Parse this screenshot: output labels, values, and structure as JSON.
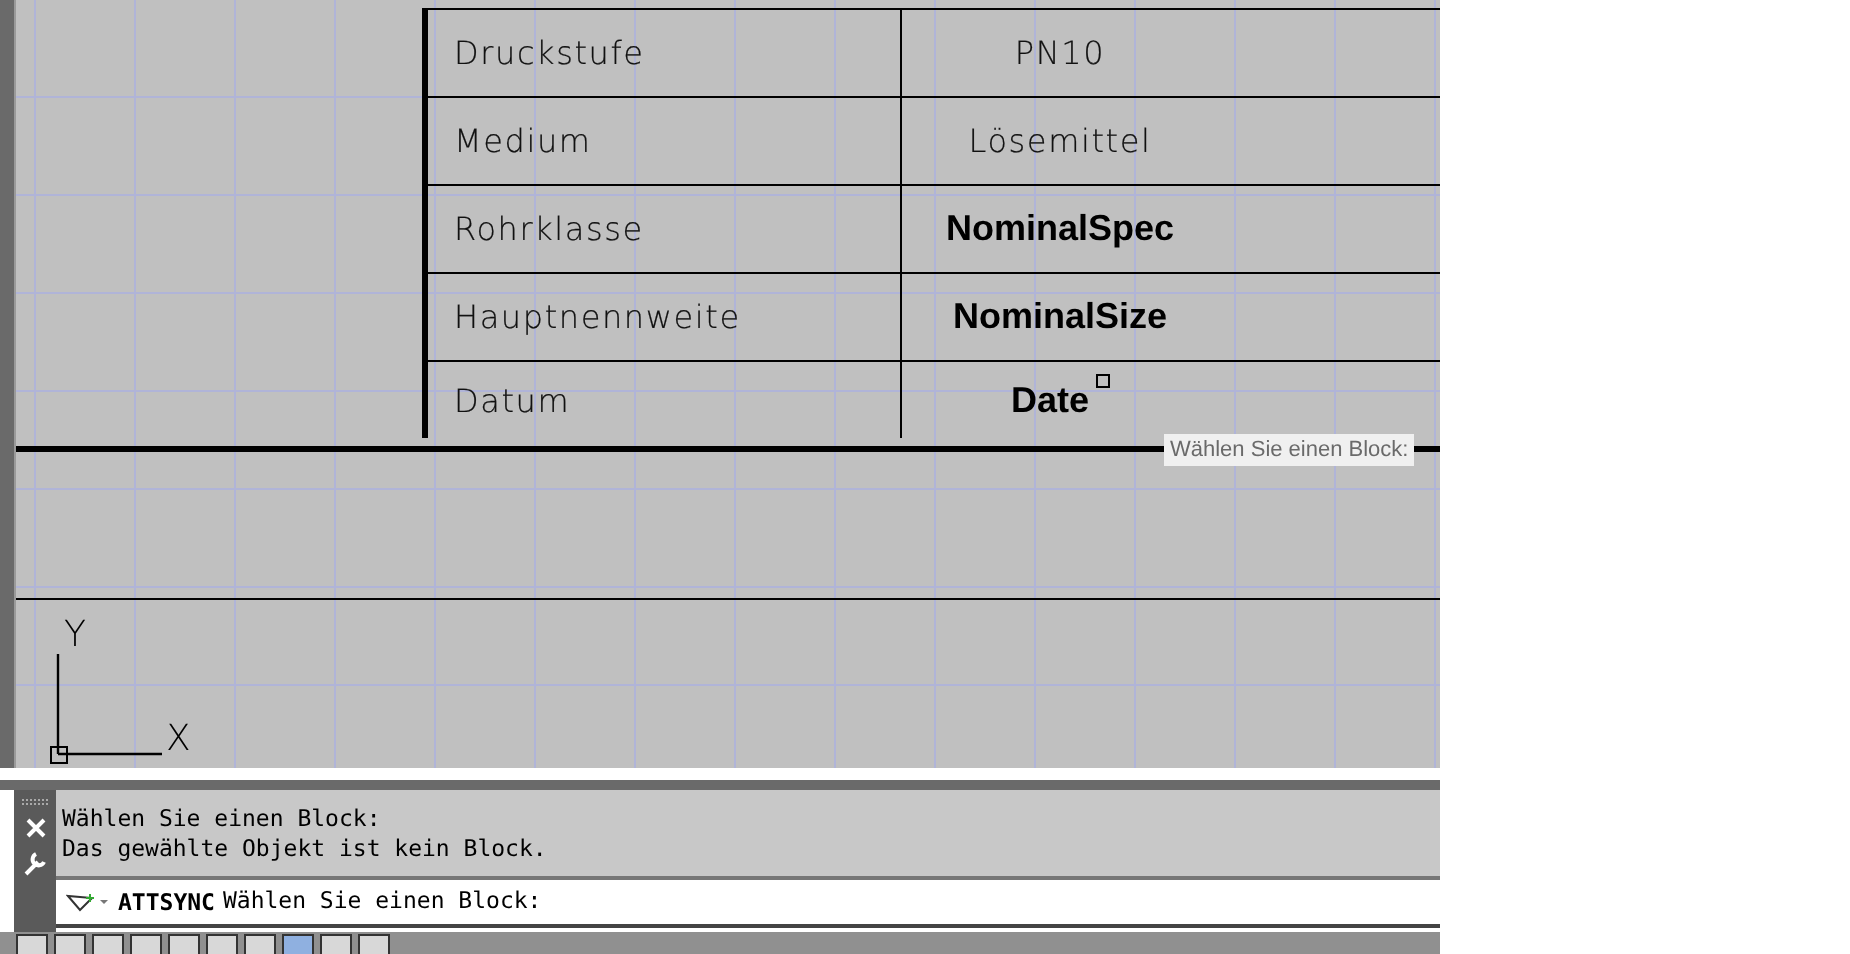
{
  "drawing": {
    "table_rows": [
      {
        "label": "Druckstufe",
        "value": "PN10",
        "kind": "text",
        "grip": false
      },
      {
        "label": "Medium",
        "value": "Lösemittel",
        "kind": "text",
        "grip": false
      },
      {
        "label": "Rohrklasse",
        "value": "NominalSpec",
        "kind": "field",
        "grip": false
      },
      {
        "label": "Hauptnennweite",
        "value": "NominalSize",
        "kind": "field",
        "grip": false
      },
      {
        "label": "Datum",
        "value": "Date",
        "kind": "field",
        "grip": true
      }
    ],
    "tooltip": "Wählen Sie einen Block:",
    "ucs": {
      "y_label": "Y",
      "x_label": "X"
    }
  },
  "command_line": {
    "history": [
      "Wählen Sie einen Block:",
      "Das gewählte Objekt ist kein Block."
    ],
    "command": "ATTSYNC",
    "prompt": "Wählen Sie einen Block:"
  }
}
